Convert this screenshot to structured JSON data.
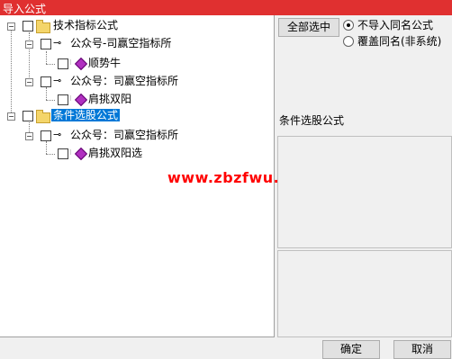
{
  "window": {
    "title": "导入公式"
  },
  "tree": {
    "nodes": [
      {
        "label": "技术指标公式"
      },
      {
        "label": "公众号-司赢空指标所"
      },
      {
        "label": "顺势牛"
      },
      {
        "label": "公众号：司赢空指标所"
      },
      {
        "label": "肩挑双阳"
      },
      {
        "label": "条件选股公式"
      },
      {
        "label": "公众号：司赢空指标所"
      },
      {
        "label": "肩挑双阳选"
      }
    ]
  },
  "watermark": "www.zbzfwu.com",
  "right": {
    "select_all_label": "全部选中",
    "radio_no_import": "不导入同名公式",
    "radio_overwrite": "覆盖同名(非系统)",
    "info_label": "条件选股公式"
  },
  "footer": {
    "ok_label": "确定",
    "cancel_label": "取消"
  }
}
